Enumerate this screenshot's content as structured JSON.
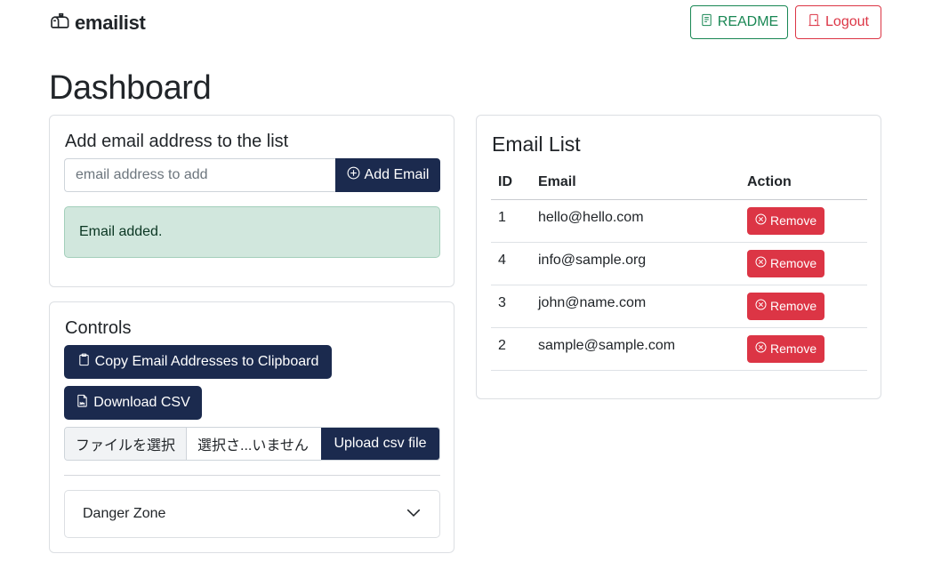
{
  "header": {
    "brand": "emailist",
    "readme_label": "README",
    "logout_label": "Logout"
  },
  "page_title": "Dashboard",
  "add_card": {
    "title": "Add email address to the list",
    "input_placeholder": "email address to add",
    "input_value": "",
    "add_button_label": "Add Email",
    "alert_text": "Email added."
  },
  "controls": {
    "title": "Controls",
    "copy_button_label": "Copy Email Addresses to Clipboard",
    "download_button_label": "Download CSV",
    "file_choose_label": "ファイルを選択",
    "file_name_text": "選択さ...いません",
    "upload_button_label": "Upload csv file",
    "danger_zone_label": "Danger Zone"
  },
  "email_list": {
    "title": "Email List",
    "columns": [
      "ID",
      "Email",
      "Action"
    ],
    "remove_label": "Remove",
    "rows": [
      {
        "id": "1",
        "email": "hello@hello.com"
      },
      {
        "id": "4",
        "email": "info@sample.org"
      },
      {
        "id": "3",
        "email": "john@name.com"
      },
      {
        "id": "2",
        "email": "sample@sample.com"
      }
    ]
  },
  "icons": {
    "brand": "mailbox-icon",
    "readme": "journal-text-icon",
    "logout": "door-icon",
    "add": "plus-circle-icon",
    "copy": "clipboard-icon",
    "csv": "file-csv-icon",
    "remove": "x-circle-icon",
    "accordion": "chevron-down-icon"
  },
  "colors": {
    "navy": "#1b2a4e",
    "success": "#198754",
    "danger": "#dc3545",
    "alert_bg": "#d1e7dd"
  }
}
